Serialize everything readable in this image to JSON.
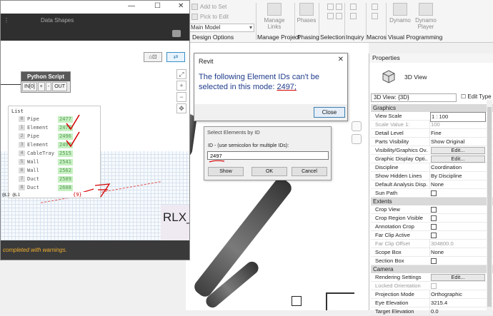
{
  "ribbon": {
    "small_items": [
      "Add to Set",
      "Pick to Edit"
    ],
    "dropdown_value": "Main Model",
    "big_buttons": [
      "Manage Links",
      "Phases",
      "Dynamo",
      "Dynamo Player"
    ],
    "panels": [
      "Design Options",
      "Manage Project",
      "Phasing",
      "Selection",
      "Inquiry",
      "Macros",
      "Visual Programming"
    ]
  },
  "dynamo": {
    "title": "Data Shapes",
    "window_buttons": [
      "—",
      "☐",
      "✕"
    ],
    "python_node": {
      "title": "Python Script",
      "ports": [
        "IN[0]",
        "+",
        "-",
        "OUT"
      ]
    },
    "list": {
      "header": "List",
      "items": [
        {
          "index": "0",
          "name": "Pipe",
          "value": "2477"
        },
        {
          "index": "1",
          "name": "Element",
          "value": "2478"
        },
        {
          "index": "2",
          "name": "Pipe",
          "value": "2496"
        },
        {
          "index": "3",
          "name": "Element",
          "value": "2497"
        },
        {
          "index": "4",
          "name": "CableTray",
          "value": "2515"
        },
        {
          "index": "5",
          "name": "Wall",
          "value": "2541"
        },
        {
          "index": "6",
          "name": "Wall",
          "value": "2562"
        },
        {
          "index": "7",
          "name": "Duct",
          "value": "2589"
        },
        {
          "index": "8",
          "name": "Duct",
          "value": "2608"
        }
      ],
      "footer": "@L2 @L1",
      "count": "{9}"
    },
    "canvas_text": "RLX_",
    "status": "completed with warnings."
  },
  "message_box": {
    "title": "Revit",
    "message_prefix": "The following Element IDs can't be selected in this mode: ",
    "message_id": "2497;",
    "close_label": "Close"
  },
  "select_dialog": {
    "title": "Select Elements by ID",
    "label": "ID - (use semicolon for multiple IDs):",
    "value": "2497",
    "buttons": [
      "Show",
      "OK",
      "Cancel"
    ]
  },
  "properties": {
    "panel_title": "Properties",
    "type_name": "3D View",
    "selector": "3D View: {3D}",
    "edit_type": "Edit Type",
    "sections": [
      {
        "title": "Graphics",
        "rows": [
          {
            "key": "View Scale",
            "value": "1 : 100",
            "kind": "box"
          },
          {
            "key": "Scale Value    1:",
            "value": "100",
            "kind": "disabled"
          },
          {
            "key": "Detail Level",
            "value": "Fine"
          },
          {
            "key": "Parts Visibility",
            "value": "Show Original"
          },
          {
            "key": "Visibility/Graphics Ov...",
            "value": "Edit...",
            "kind": "button"
          },
          {
            "key": "Graphic Display Opti...",
            "value": "Edit...",
            "kind": "button"
          },
          {
            "key": "Discipline",
            "value": "Coordination"
          },
          {
            "key": "Show Hidden Lines",
            "value": "By Discipline"
          },
          {
            "key": "Default Analysis Disp...",
            "value": "None"
          },
          {
            "key": "Sun Path",
            "value": "",
            "kind": "check"
          }
        ]
      },
      {
        "title": "Extents",
        "rows": [
          {
            "key": "Crop View",
            "value": "",
            "kind": "check"
          },
          {
            "key": "Crop Region Visible",
            "value": "",
            "kind": "check"
          },
          {
            "key": "Annotation Crop",
            "value": "",
            "kind": "check"
          },
          {
            "key": "Far Clip Active",
            "value": "",
            "kind": "check"
          },
          {
            "key": "Far Clip Offset",
            "value": "304800.0",
            "kind": "disabled"
          },
          {
            "key": "Scope Box",
            "value": "None"
          },
          {
            "key": "Section Box",
            "value": "",
            "kind": "check"
          }
        ]
      },
      {
        "title": "Camera",
        "rows": [
          {
            "key": "Rendering Settings",
            "value": "Edit...",
            "kind": "button"
          },
          {
            "key": "Locked Orientation",
            "value": "",
            "kind": "disabled-check"
          },
          {
            "key": "Projection Mode",
            "value": "Orthographic"
          },
          {
            "key": "Eye Elevation",
            "value": "3215.4"
          },
          {
            "key": "Target Elevation",
            "value": "0.0"
          }
        ]
      }
    ]
  },
  "colors": {
    "accent_blue": "#1f3c8c",
    "warning": "#f0b030",
    "annotation_red": "#d40000",
    "list_value_bg": "#c6f0c2"
  }
}
